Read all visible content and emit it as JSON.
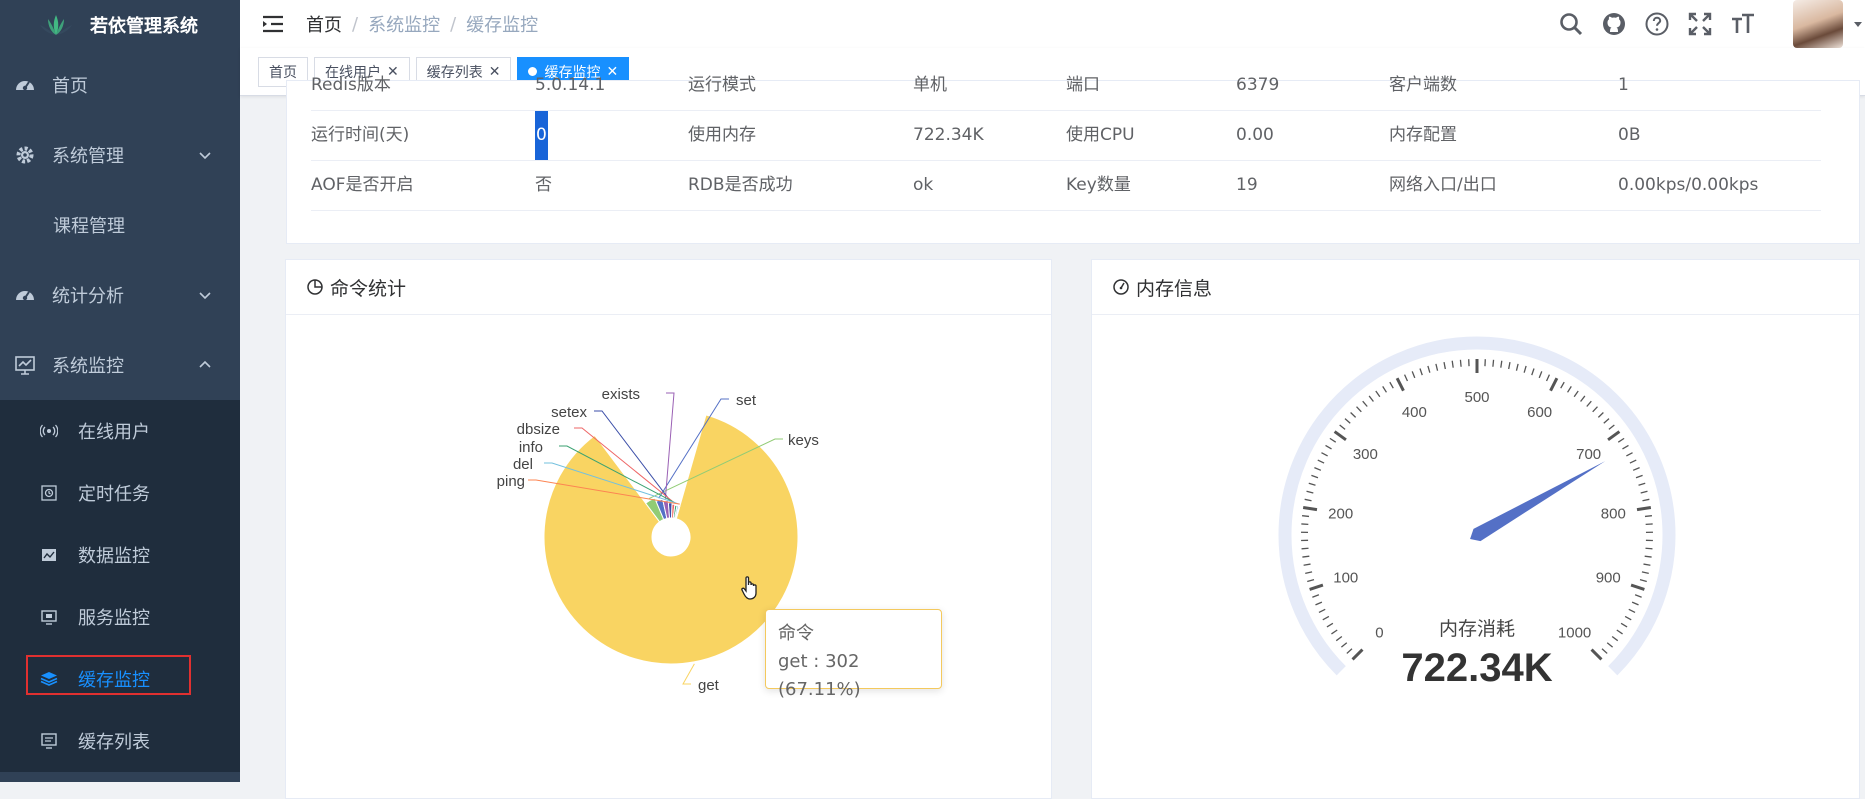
{
  "app": {
    "title": "若依管理系统"
  },
  "sidebar": {
    "items": [
      {
        "label": "首页",
        "icon": "dashboard-icon"
      },
      {
        "label": "系统管理",
        "icon": "gear-icon",
        "expanded": false
      },
      {
        "label": "课程管理"
      },
      {
        "label": "统计分析",
        "icon": "dashboard-icon",
        "expanded": false
      },
      {
        "label": "系统监控",
        "icon": "monitor-icon",
        "expanded": true
      }
    ],
    "submenu": [
      {
        "label": "在线用户",
        "icon": "online-icon"
      },
      {
        "label": "定时任务",
        "icon": "job-icon"
      },
      {
        "label": "数据监控",
        "icon": "druid-icon"
      },
      {
        "label": "服务监控",
        "icon": "server-icon"
      },
      {
        "label": "缓存监控",
        "icon": "redis-icon",
        "active": true
      },
      {
        "label": "缓存列表",
        "icon": "redis-list-icon"
      }
    ]
  },
  "navbar": {
    "breadcrumb": [
      "首页",
      "系统监控",
      "缓存监控"
    ],
    "icons": [
      "search-icon",
      "github-icon",
      "question-icon",
      "fullscreen-icon",
      "font-size-icon"
    ]
  },
  "tags": [
    {
      "label": "首页",
      "closable": false
    },
    {
      "label": "在线用户",
      "closable": true
    },
    {
      "label": "缓存列表",
      "closable": true
    },
    {
      "label": "缓存监控",
      "closable": true,
      "active": true
    }
  ],
  "info": {
    "rows": [
      [
        "Redis版本",
        "5.0.14.1",
        "运行模式",
        "单机",
        "端口",
        "6379",
        "客户端数",
        "1"
      ],
      [
        "运行时间(天)",
        "0",
        "使用内存",
        "722.34K",
        "使用CPU",
        "0.00",
        "内存配置",
        "0B"
      ],
      [
        "AOF是否开启",
        "否",
        "RDB是否成功",
        "ok",
        "Key数量",
        "19",
        "网络入口/出口",
        "0.00kps/0.00kps"
      ]
    ]
  },
  "cards": {
    "command": {
      "title": "命令统计"
    },
    "memory": {
      "title": "内存信息"
    }
  },
  "tooltip": {
    "title": "命令",
    "text": "get : 302 (67.11%)"
  },
  "chart_data": [
    {
      "type": "pie",
      "title": "命令统计",
      "roseType": "radius",
      "series": [
        {
          "name": "命令",
          "slices": [
            {
              "label": "get",
              "value": 302,
              "color": "#f9d462"
            },
            {
              "label": "keys",
              "value": 14,
              "color": "#91cc75"
            },
            {
              "label": "set",
              "value": 10,
              "color": "#5470c6"
            },
            {
              "label": "exists",
              "value": 8,
              "color": "#9a60b4"
            },
            {
              "label": "setex",
              "value": 6,
              "color": "#3b4ea8"
            },
            {
              "label": "dbsize",
              "value": 5,
              "color": "#ee6666"
            },
            {
              "label": "info",
              "value": 4,
              "color": "#3ba272"
            },
            {
              "label": "del",
              "value": 3,
              "color": "#73c0de"
            },
            {
              "label": "ping",
              "value": 2,
              "color": "#fc8452"
            }
          ]
        }
      ]
    },
    {
      "type": "gauge",
      "title": "内存信息",
      "min": 0,
      "max": 1000,
      "ticks": [
        "0",
        "100",
        "200",
        "300",
        "400",
        "500",
        "600",
        "700",
        "800",
        "900",
        "1000"
      ],
      "detail_label": "内存消耗",
      "value": 722.34,
      "value_text": "722.34K",
      "colors": {
        "axis": "#e6ebf8",
        "pointer": "#5470c6",
        "tick": "#555555"
      }
    }
  ]
}
